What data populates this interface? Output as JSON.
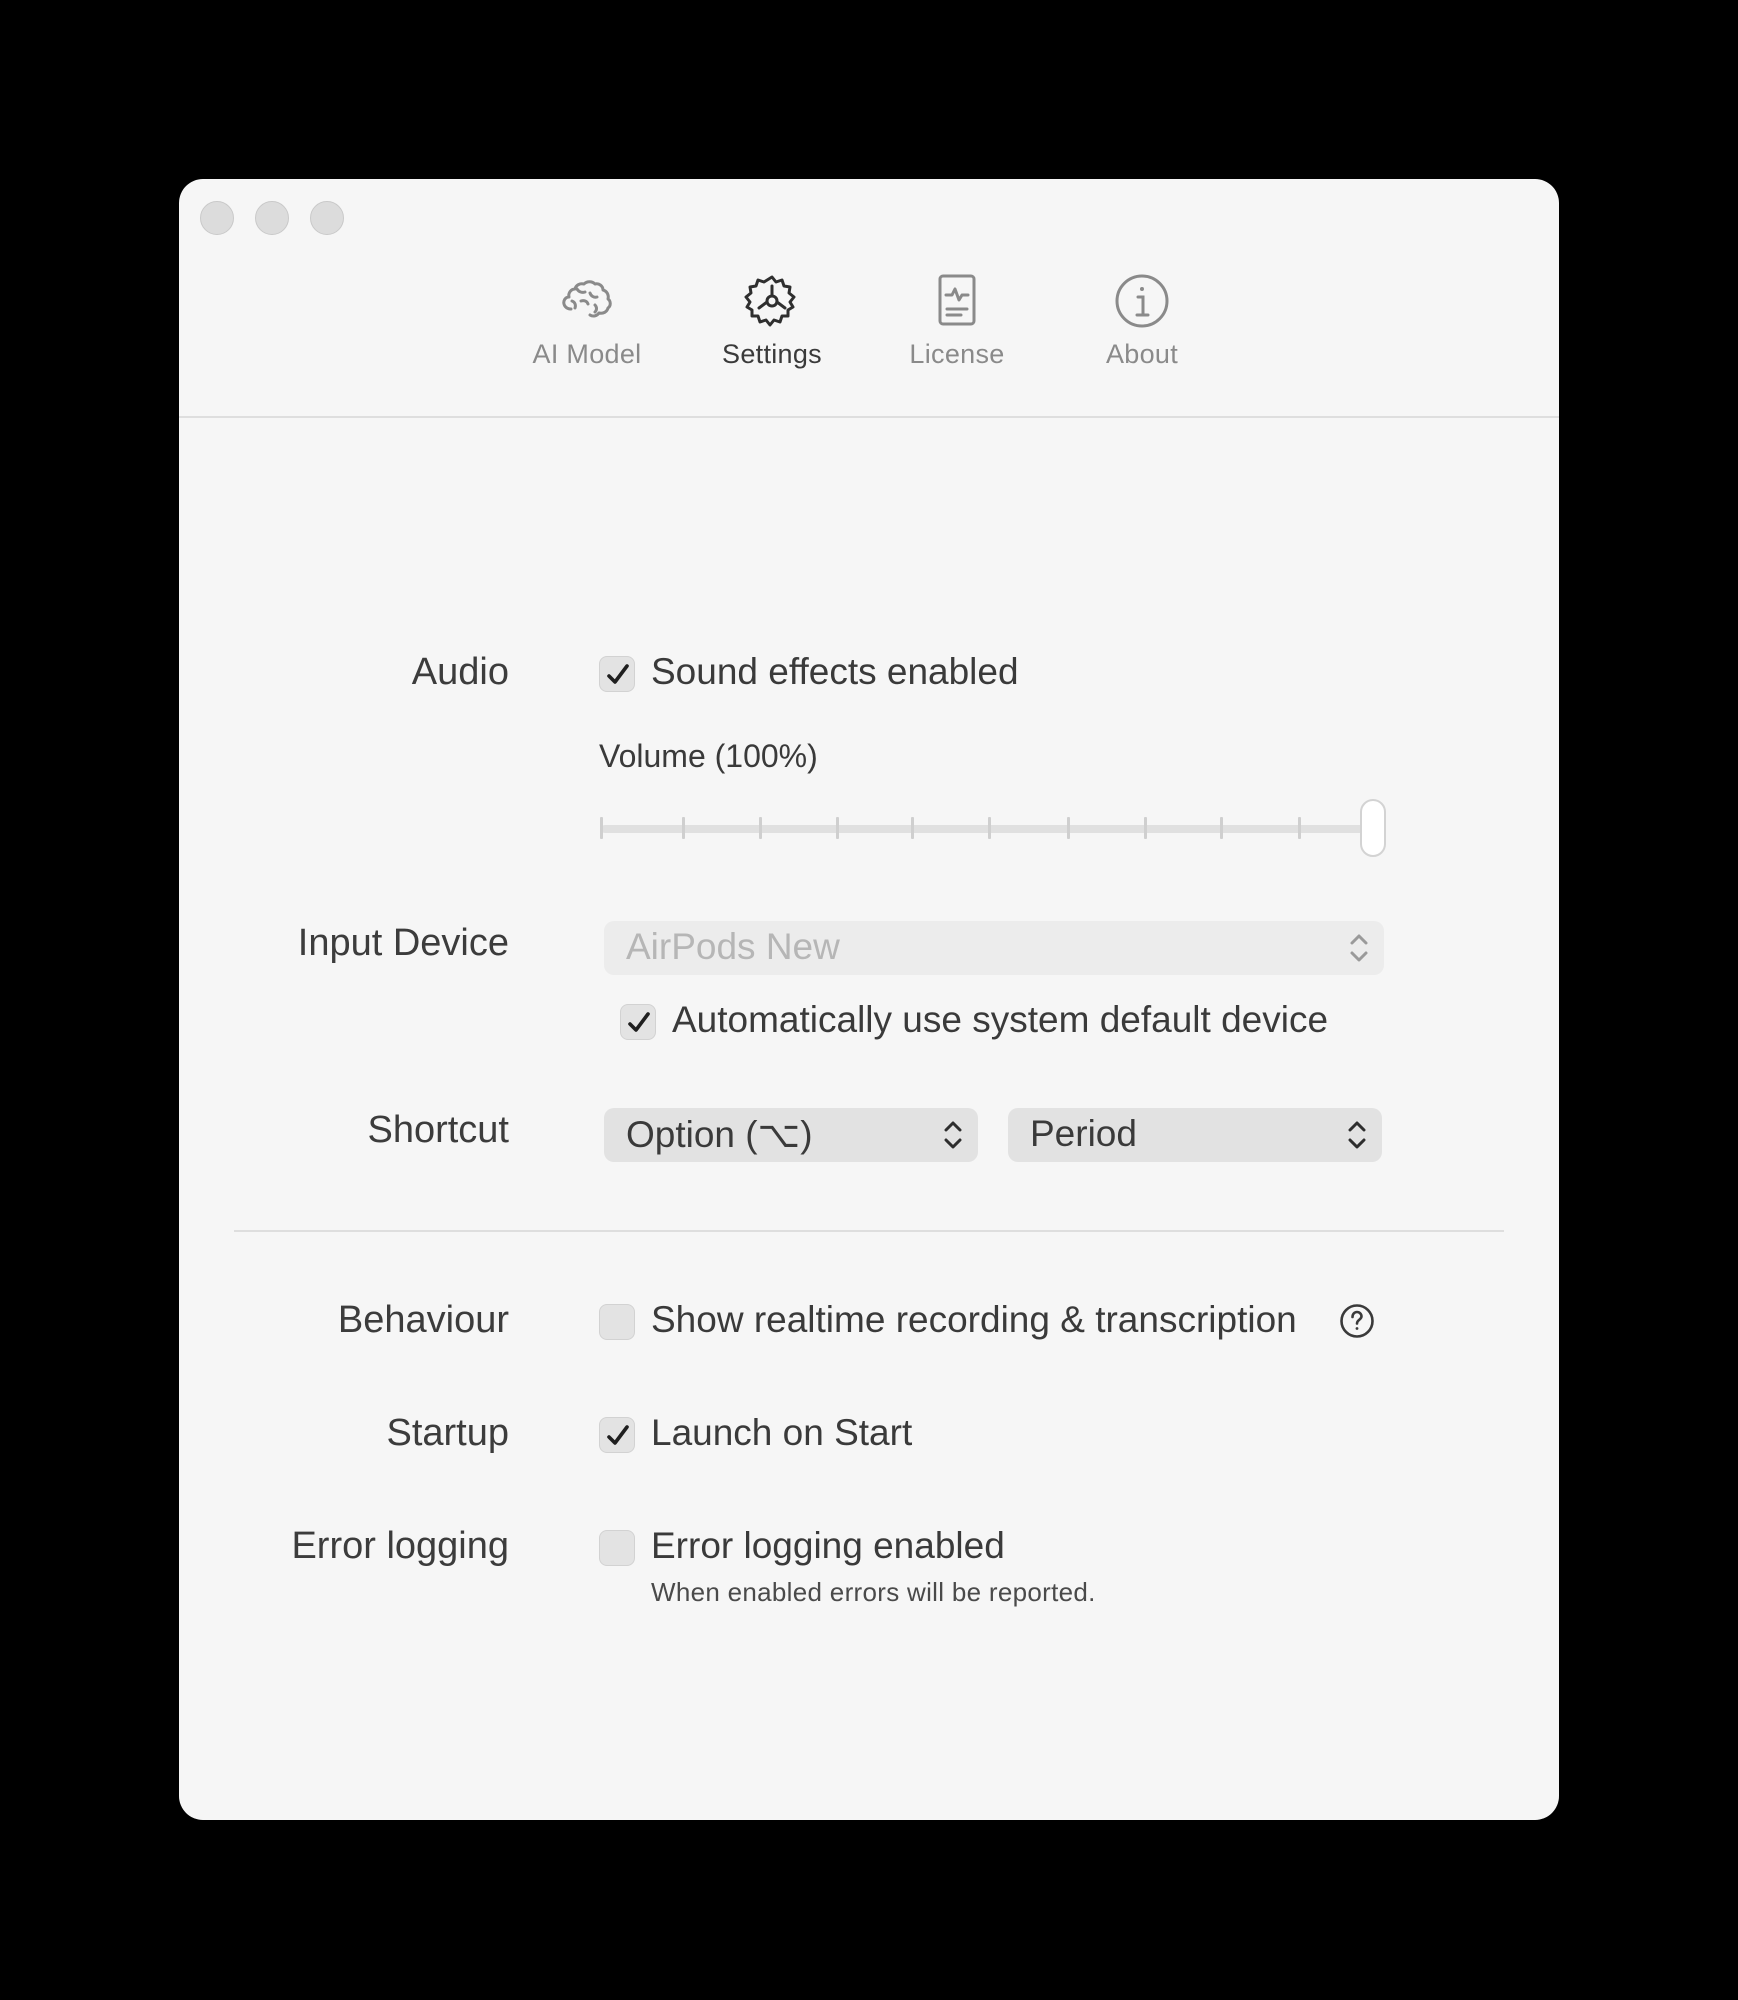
{
  "window": {
    "traffic_lights": [
      "close",
      "minimize",
      "zoom"
    ]
  },
  "toolbar": {
    "tabs": [
      {
        "label": "AI Model",
        "icon": "brain-icon",
        "active": false
      },
      {
        "label": "Settings",
        "icon": "gear-icon",
        "active": true
      },
      {
        "label": "License",
        "icon": "license-document-icon",
        "active": false
      },
      {
        "label": "About",
        "icon": "info-icon",
        "active": false
      }
    ]
  },
  "audio": {
    "label": "Audio",
    "sound_effects": {
      "label": "Sound effects enabled",
      "checked": true
    },
    "volume": {
      "label": "Volume (100%)",
      "value_percent": 100,
      "tick_count": 11
    }
  },
  "input_device": {
    "label": "Input Device",
    "selected": "AirPods New",
    "disabled": true,
    "auto_default": {
      "label": "Automatically use system default device",
      "checked": true
    }
  },
  "shortcut": {
    "label": "Shortcut",
    "modifier": "Option (⌥)",
    "key": "Period"
  },
  "behaviour": {
    "label": "Behaviour",
    "realtime": {
      "label": "Show realtime recording & transcription",
      "checked": false
    },
    "help_icon": "question-mark-circle-icon"
  },
  "startup": {
    "label": "Startup",
    "launch": {
      "label": "Launch on Start",
      "checked": true
    }
  },
  "error_logging": {
    "label": "Error logging",
    "enabled": {
      "label": "Error logging enabled",
      "checked": false
    },
    "description": "When enabled errors will be reported."
  }
}
